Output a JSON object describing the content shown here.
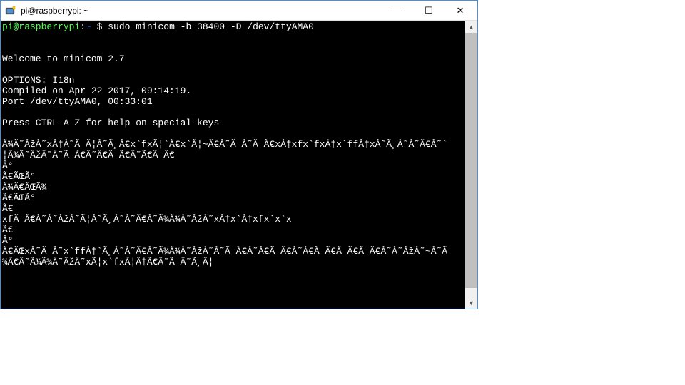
{
  "titlebar": {
    "title": "pi@raspberrypi: ~",
    "minimize": "—",
    "maximize": "☐",
    "close": "✕"
  },
  "terminal": {
    "prompt_user_host": "pi@raspberrypi",
    "prompt_separator": ":",
    "prompt_path": "~",
    "prompt_dollar": " $ ",
    "command": "sudo minicom -b 38400 -D /dev/ttyAMA0",
    "lines": [
      "",
      "",
      "Welcome to minicom 2.7",
      "",
      "OPTIONS: I18n",
      "Compiled on Apr 22 2017, 09:14:19.",
      "Port /dev/ttyAMA0, 00:33:01",
      "",
      "Press CTRL-A Z for help on special keys",
      "",
      "Ã¾Ã˜ÂžÂ˜xÂ†Â˜Ã Ã¦Â˜Ã¸Â€x`fxÃ¦`Ã€x`Ã¦~Ã€Â˜Ã Â˜Ã Ã€xÂ†xfx`fxÂ†x`ffÂ†xÂ˜Ã¸Â˜Â˜Ã€Â˜`",
      "¦Ã¾Ã˜ÂžÂ˜Â˜Ã Ã€Â˜Â€Ã Ã€Â˜Ã€Ã Â€",
      "Â°",
      "Ã€ÃŒÃ°",
      "Ã¾Ã€ÃŒÃ¾",
      "Ã€ÃŒÃ°",
      "Ã€",
      "xfÃ Ã€Â˜Â˜ÂžÂ˜Ã¦Â˜Ã¸Â˜Â˜Ã€Â˜Ã¾Ã¾Â˜ÂžÂ˜xÂ†x`Â†xfx`x`x",
      "Ã€",
      "Â°",
      "Ã€ÃŒxÂ˜Ã Â˜x`ffÂ†`Ã¸Â˜Â˜Ã€Â˜Ã¾Ã¾Â˜ÂžÂ˜Â˜Ã Ã€Â˜Â€Ã Ã€Â˜Â€Ã Ã€Ã Ã€Ã Ã€Â˜Â˜ÂžÂ˜~Â˜Ã",
      "¾Ã€Â˜Ã¾Ã¾Â˜ÂžÂ˜xÃ¦x`fxÃ¦Â†Ã€Â˜Ã Â˜Ã¸Â¦"
    ]
  },
  "scrollbar": {
    "up_arrow": "▲",
    "down_arrow": "▼"
  }
}
